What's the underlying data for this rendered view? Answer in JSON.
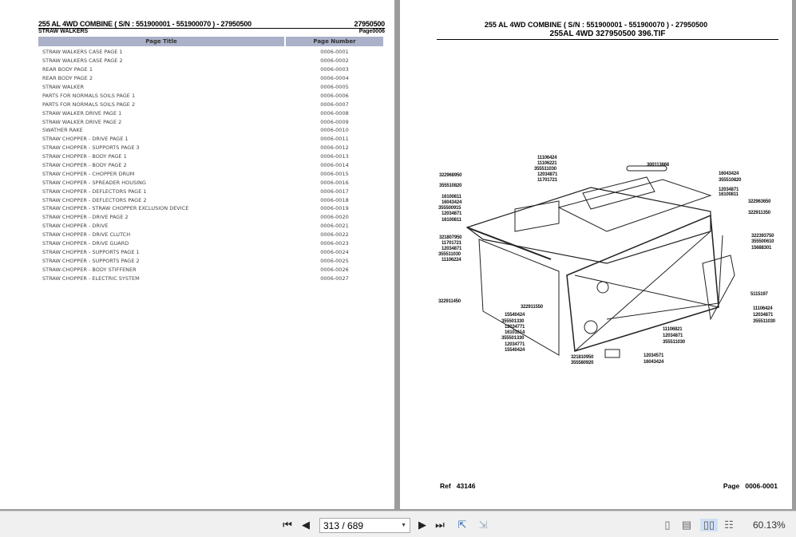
{
  "left_page": {
    "title": "255 AL 4WD   COMBINE    ( S/N :    551900001 - 551900070 ) - 27950500",
    "code": "27950500",
    "section": "STRAW WALKERS",
    "page_label": "Page0006",
    "columns": [
      "Page Title",
      "Page Number"
    ],
    "rows": [
      [
        "STRAW WALKERS CASE PAGE 1",
        "0006-0001"
      ],
      [
        "STRAW WALKERS CASE PAGE 2",
        "0006-0002"
      ],
      [
        "REAR BODY PAGE 1",
        "0006-0003"
      ],
      [
        "REAR BODY PAGE 2",
        "0006-0004"
      ],
      [
        "STRAW WALKER",
        "0006-0005"
      ],
      [
        "PARTS FOR NORMALS SOILS PAGE 1",
        "0006-0006"
      ],
      [
        "PARTS FOR NORMALS SOILS PAGE 2",
        "0006-0007"
      ],
      [
        "STRAW WALKER DRIVE PAGE 1",
        "0006-0008"
      ],
      [
        "STRAW WALKER DRIVE PAGE 2",
        "0006-0009"
      ],
      [
        "SWATHER RAKE",
        "0006-0010"
      ],
      [
        "STRAW CHOPPER - DRIVE PAGE 1",
        "0006-0011"
      ],
      [
        "STRAW CHOPPER - SUPPORTS PAGE 3",
        "0006-0012"
      ],
      [
        "STRAW CHOPPER - BODY PAGE 1",
        "0006-0013"
      ],
      [
        "STRAW CHOPPER - BODY PAGE 2",
        "0006-0014"
      ],
      [
        "STRAW CHOPPER - CHOPPER DRUM",
        "0006-0015"
      ],
      [
        "STRAW CHOPPER - SPREADER HOUSING",
        "0006-0016"
      ],
      [
        "STRAW CHOPPER - DEFLECTORS PAGE 1",
        "0006-0017"
      ],
      [
        "STRAW CHOPPER - DEFLECTORS PAGE 2",
        "0006-0018"
      ],
      [
        "STRAW CHOPPER - STRAW CHOPPER EXCLUSION DEVICE",
        "0006-0019"
      ],
      [
        "STRAW CHOPPER - DRIVE PAGE 2",
        "0006-0020"
      ],
      [
        "STRAW CHOPPER - DRIVE",
        "0006-0021"
      ],
      [
        "STRAW CHOPPER - DRIVE CLUTCH",
        "0006-0022"
      ],
      [
        "STRAW CHOPPER - DRIVE GUARD",
        "0006-0023"
      ],
      [
        "STRAW CHOPPER - SUPPORTS PAGE 1",
        "0006-0024"
      ],
      [
        "STRAW CHOPPER - SUPPORTS PAGE 2",
        "0006-0025"
      ],
      [
        "STRAW-CHOPPER - BODY STIFFENER",
        "0006-0026"
      ],
      [
        "STRAW CHOPPER - ELECTRIC SYSTEM",
        "0006-0027"
      ]
    ]
  },
  "right_page": {
    "title": "255 AL 4WD   COMBINE    ( S/N :    551900001 - 551900070 ) - 27950500",
    "subtitle": "255AL 4WD 327950500 396.TIF",
    "part_labels": [
      "11106424",
      "11106221",
      "355511030",
      "12034871",
      "11701721",
      "322968950",
      "355510820",
      "16100811",
      "16043424",
      "355500915",
      "12034871",
      "16100811",
      "321807950",
      "11701721",
      "12034871",
      "355511030",
      "11106224",
      "300113868",
      "16043424",
      "355510820",
      "12034871",
      "16100811",
      "322963650",
      "322911350",
      "322393750",
      "355500610",
      "15688301",
      "5115197",
      "322911450",
      "322911550",
      "15540424",
      "355501330",
      "12034771",
      "16101614",
      "355501330",
      "12034771",
      "15540424",
      "11106424",
      "12034871",
      "355511030",
      "11106821",
      "12034871",
      "355511030",
      "321810950",
      "355580920",
      "12034571",
      "16043424"
    ],
    "ref_label": "Ref",
    "ref_value": "43146",
    "page_label": "Page",
    "page_value": "0006-0001"
  },
  "toolbar": {
    "page_input": "313 / 689",
    "zoom": "60.13%",
    "icons": [
      "first-page-icon",
      "prev-page-icon",
      "next-page-icon",
      "last-page-icon",
      "go-back-icon",
      "go-forward-icon",
      "single-page-icon",
      "continuous-icon",
      "facing-icon",
      "continuous-facing-icon"
    ]
  }
}
